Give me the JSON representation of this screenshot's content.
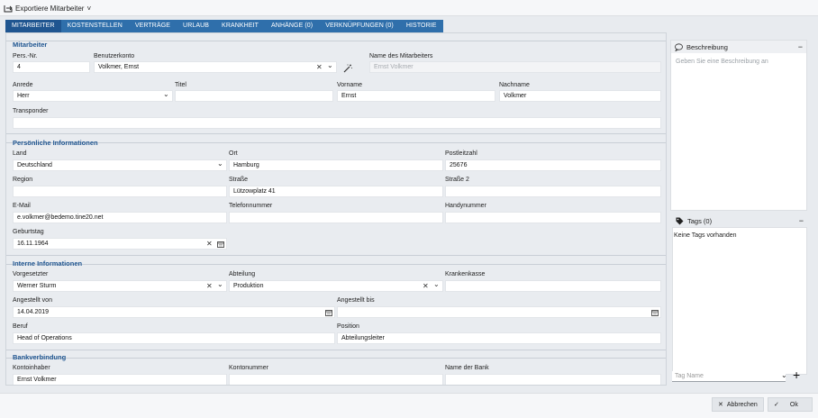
{
  "toolbar": {
    "export_label": "Exportiere Mitarbeiter",
    "export_chevron": "˅"
  },
  "tabs": [
    "MITARBEITER",
    "KOSTENSTELLEN",
    "VERTRÄGE",
    "URLAUB",
    "KRANKHEIT",
    "ANHÄNGE (0)",
    "VERKNÜPFUNGEN (0)",
    "HISTORIE"
  ],
  "mitarbeiter": {
    "title": "Mitarbeiter",
    "pers_nr_label": "Pers.-Nr.",
    "pers_nr": "4",
    "konto_label": "Benutzerkonto",
    "konto": "Volkmer, Ernst",
    "name_label": "Name des Mitarbeiters",
    "name_placeholder": "Ernst Volkmer",
    "anrede_label": "Anrede",
    "anrede": "Herr",
    "titel_label": "Titel",
    "titel": "",
    "vorname_label": "Vorname",
    "vorname": "Ernst",
    "nachname_label": "Nachname",
    "nachname": "Volkmer",
    "transponder_label": "Transponder",
    "transponder": ""
  },
  "persoenlich": {
    "title": "Persönliche Informationen",
    "land_label": "Land",
    "land": "Deutschland",
    "ort_label": "Ort",
    "ort": "Hamburg",
    "plz_label": "Postleitzahl",
    "plz": "25676",
    "region_label": "Region",
    "region": "",
    "strasse_label": "Straße",
    "strasse": "Lützowplatz 41",
    "strasse2_label": "Straße 2",
    "strasse2": "",
    "email_label": "E-Mail",
    "email": "e.volkmer@bedemo.tine20.net",
    "telefon_label": "Telefonnummer",
    "telefon": "",
    "handy_label": "Handynummer",
    "handy": "",
    "geburtstag_label": "Geburtstag",
    "geburtstag": "16.11.1964"
  },
  "intern": {
    "title": "Interne Informationen",
    "vorgesetzter_label": "Vorgesetzter",
    "vorgesetzter": "Werner Sturm",
    "abteilung_label": "Abteilung",
    "abteilung": "Produktion",
    "kasse_label": "Krankenkasse",
    "kasse": "",
    "von_label": "Angestellt von",
    "von": "14.04.2019",
    "bis_label": "Angestellt bis",
    "bis": "",
    "beruf_label": "Beruf",
    "beruf": "Head of Operations",
    "position_label": "Position",
    "position": "Abteilungsleiter"
  },
  "bank": {
    "title": "Bankverbindung",
    "inhaber_label": "Kontoinhaber",
    "inhaber": "Ernst Volkmer",
    "nummer_label": "Kontonummer",
    "nummer": "",
    "bankname_label": "Name der Bank",
    "bankname": ""
  },
  "beschreibung": {
    "title": "Beschreibung",
    "placeholder": "Geben Sie eine Beschreibung an"
  },
  "tags": {
    "title": "Tags (0)",
    "empty": "Keine Tags vorhanden",
    "name_placeholder": "Tag Name"
  },
  "footer": {
    "cancel": "Abbrechen",
    "ok": "Ok"
  },
  "glyphs": {
    "clear": "✕",
    "chevron": "⌄",
    "minus": "−",
    "plus": "+",
    "check": "✓"
  }
}
